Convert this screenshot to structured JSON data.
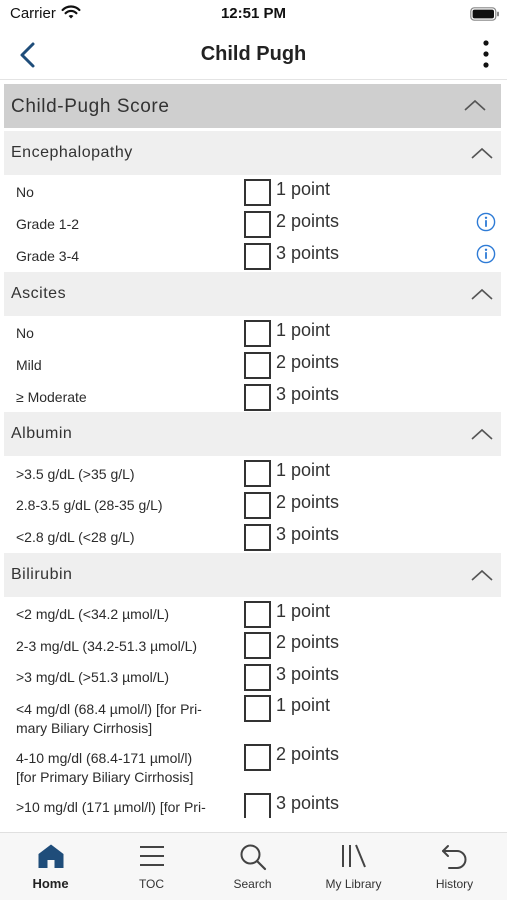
{
  "status_bar": {
    "carrier": "Carrier",
    "time": "12:51 PM"
  },
  "nav": {
    "title": "Child Pugh"
  },
  "score": {
    "title": "Child-Pugh Score"
  },
  "sections": {
    "encephalopathy": {
      "title": "Encephalopathy",
      "rows": [
        {
          "label": "No",
          "points": "1 point"
        },
        {
          "label": "Grade 1-2",
          "points": "2 points"
        },
        {
          "label": "Grade 3-4",
          "points": "3 points"
        }
      ]
    },
    "ascites": {
      "title": "Ascites",
      "rows": [
        {
          "label": "No",
          "points": "1 point"
        },
        {
          "label": "Mild",
          "points": "2 points"
        },
        {
          "label": "≥ Moderate",
          "points": "3 points"
        }
      ]
    },
    "albumin": {
      "title": "Albumin",
      "rows": [
        {
          "label": ">3.5 g/dL (>35 g/L)",
          "points": "1 point"
        },
        {
          "label": "2.8-3.5 g/dL (28-35 g/L)",
          "points": "2 points"
        },
        {
          "label": "<2.8 g/dL (<28 g/L)",
          "points": "3 points"
        }
      ]
    },
    "bilirubin": {
      "title": "Bilirubin",
      "rows": [
        {
          "label": "<2 mg/dL (<34.2 µmol/L)",
          "points": "1 point"
        },
        {
          "label": "2-3 mg/dL (34.2-51.3 µmol/L)",
          "points": "2 points"
        },
        {
          "label": ">3 mg/dL (>51.3 µmol/L)",
          "points": "3 points"
        },
        {
          "label_line1": "<4 mg/dl (68.4 µmol/l) [for Pri-",
          "label_line2": "mary Biliary Cirrhosis]",
          "points": "1 point"
        },
        {
          "label_line1": "4-10 mg/dl (68.4-171 µmol/l)",
          "label_line2": "[for Primary Biliary Cirrhosis]",
          "points": "2 points"
        },
        {
          "label_line1": ">10 mg/dl (171 µmol/l) [for Pri-",
          "points": "3 points"
        }
      ]
    }
  },
  "tabs": [
    {
      "label": "Home",
      "icon": "home-icon",
      "active": true
    },
    {
      "label": "TOC",
      "icon": "toc-icon"
    },
    {
      "label": "Search",
      "icon": "search-icon"
    },
    {
      "label": "My Library",
      "icon": "library-icon"
    },
    {
      "label": "History",
      "icon": "history-icon"
    }
  ],
  "colors": {
    "accent": "#1f4d7a",
    "info": "#2e7bd6",
    "section_bg": "#efefef",
    "header_bg": "#cfcfcf"
  }
}
